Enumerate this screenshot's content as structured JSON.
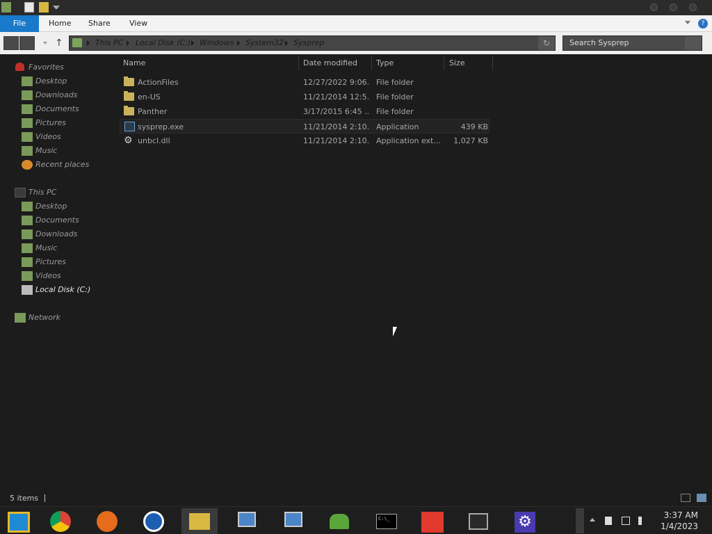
{
  "ribbon": {
    "file": "File",
    "home": "Home",
    "share": "Share",
    "view": "View"
  },
  "address": {
    "crumbs": [
      "This PC",
      "Local Disk (C:)",
      "Windows",
      "System32",
      "Sysprep"
    ]
  },
  "search": {
    "placeholder": "Search Sysprep"
  },
  "nav": {
    "favorites": "Favorites",
    "fav_items": [
      "Desktop",
      "Downloads",
      "Documents",
      "Pictures",
      "Videos",
      "Music",
      "Recent places"
    ],
    "thispc": "This PC",
    "pc_items": [
      "Desktop",
      "Documents",
      "Downloads",
      "Music",
      "Pictures",
      "Videos",
      "Local Disk (C:)"
    ],
    "network": "Network"
  },
  "columns": {
    "name": "Name",
    "date": "Date modified",
    "type": "Type",
    "size": "Size"
  },
  "files": [
    {
      "name": "ActionFiles",
      "date": "12/27/2022 9:06...",
      "type": "File folder",
      "size": "",
      "icon": "folder-icon"
    },
    {
      "name": "en-US",
      "date": "11/21/2014 12:5...",
      "type": "File folder",
      "size": "",
      "icon": "folder-icon"
    },
    {
      "name": "Panther",
      "date": "3/17/2015 6:45 ...",
      "type": "File folder",
      "size": "",
      "icon": "folder-icon"
    },
    {
      "name": "sysprep.exe",
      "date": "11/21/2014 2:10...",
      "type": "Application",
      "size": "439 KB",
      "icon": "exe-icon"
    },
    {
      "name": "unbcl.dll",
      "date": "11/21/2014 2:10...",
      "type": "Application ext...",
      "size": "1,027 KB",
      "icon": "gear-icon"
    }
  ],
  "status": {
    "items": "5 items"
  },
  "clock": {
    "time": "3:37 AM",
    "date": "1/4/2023"
  },
  "taskbar": [
    "start-icon",
    "chrome-icon",
    "firefox-icon",
    "ie-icon",
    "file-explorer-icon",
    "computer-icon",
    "computer-icon",
    "people-icon",
    "cmd-icon",
    "anydesk-icon",
    "archive-icon",
    "settings-icon"
  ]
}
